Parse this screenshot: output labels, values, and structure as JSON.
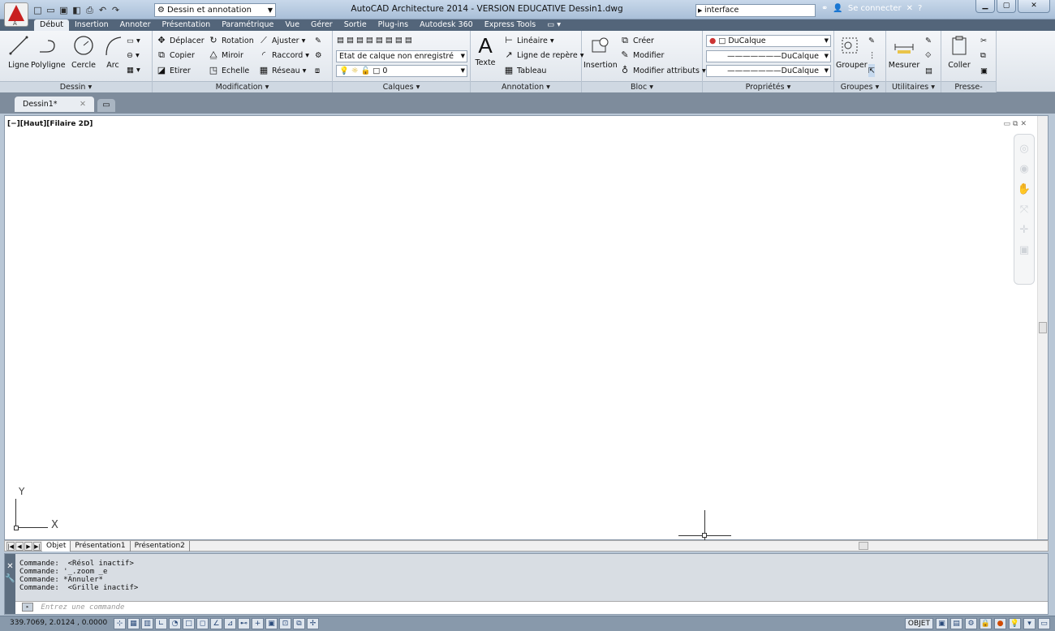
{
  "titlebar": {
    "logo_letter": "A",
    "workspace": "Dessin et annotation",
    "title": "AutoCAD Architecture 2014 - VERSION EDUCATIVE    Dessin1.dwg",
    "search_value": "interface",
    "sign_in": "Se connecter"
  },
  "ribbon_tabs": [
    "Début",
    "Insertion",
    "Annoter",
    "Présentation",
    "Paramétrique",
    "Vue",
    "Gérer",
    "Sortie",
    "Plug-ins",
    "Autodesk 360",
    "Express Tools"
  ],
  "panels": {
    "dessin": {
      "title": "Dessin ▾",
      "ligne": "Ligne",
      "polyligne": "Polyligne",
      "cercle": "Cercle",
      "arc": "Arc"
    },
    "modification": {
      "title": "Modification ▾",
      "deplacer": "Déplacer",
      "rotation": "Rotation",
      "ajuster": "Ajuster",
      "copier": "Copier",
      "miroir": "Miroir",
      "raccord": "Raccord",
      "etirer": "Etirer",
      "echelle": "Echelle",
      "reseau": "Réseau"
    },
    "calques": {
      "title": "Calques ▾",
      "layer_state": "Etat de calque non enregistré",
      "layer_current": "0"
    },
    "annotation": {
      "title": "Annotation ▾",
      "texte": "Texte",
      "lineaire": "Linéaire",
      "ligne_repere": "Ligne de repère",
      "tableau": "Tableau"
    },
    "bloc": {
      "title": "Bloc ▾",
      "insertion": "Insertion",
      "creer": "Créer",
      "modifier": "Modifier",
      "modifier_attributs": "Modifier attributs"
    },
    "proprietes": {
      "title": "Propriétés ▾",
      "color": "DuCalque",
      "linetype": "DuCalque",
      "lineweight": "DuCalque"
    },
    "groupes": {
      "title": "Groupes ▾",
      "grouper": "Grouper"
    },
    "utilitaires": {
      "title": "Utilitaires ▾",
      "mesurer": "Mesurer"
    },
    "presse_papiers": {
      "title": "Presse-papiers",
      "coller": "Coller"
    }
  },
  "doc_tab": {
    "name": "Dessin1*"
  },
  "viewport": {
    "label": "[−][Haut][Filaire 2D]",
    "axis_y": "Y",
    "axis_x": "X"
  },
  "layout_tabs": [
    "Objet",
    "Présentation1",
    "Présentation2"
  ],
  "command": {
    "history": [
      "Commande:  <Résol inactif>",
      "Commande: '_.zoom _e",
      "Commande: *Annuler*",
      "Commande:  <Grille inactif>"
    ],
    "placeholder": "Entrez une commande"
  },
  "status": {
    "coords": "339.7069, 2.0124 , 0.0000",
    "objet": "OBJET"
  },
  "colors": {
    "accent_red": "#c8201f",
    "ribbon_tab_bg": "#53657a",
    "drawing_bg": "#ffffff"
  }
}
